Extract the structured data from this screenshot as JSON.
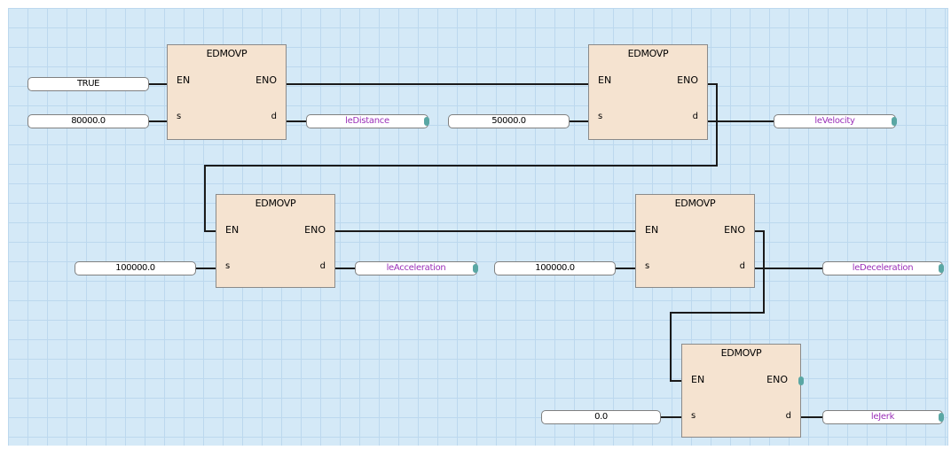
{
  "colors": {
    "grid_background": "#d4e9f7",
    "block_fill": "#f5e3d0",
    "variable_text": "#9a2fb8",
    "connector_dot": "#5aa7a4"
  },
  "blocks": [
    {
      "title": "EDMOVP",
      "en": "EN",
      "eno": "ENO",
      "s": "s",
      "d": "d"
    },
    {
      "title": "EDMOVP",
      "en": "EN",
      "eno": "ENO",
      "s": "s",
      "d": "d"
    },
    {
      "title": "EDMOVP",
      "en": "EN",
      "eno": "ENO",
      "s": "s",
      "d": "d"
    },
    {
      "title": "EDMOVP",
      "en": "EN",
      "eno": "ENO",
      "s": "s",
      "d": "d"
    },
    {
      "title": "EDMOVP",
      "en": "EN",
      "eno": "ENO",
      "s": "s",
      "d": "d"
    }
  ],
  "inputs": {
    "enable": "TRUE",
    "distance_value": "80000.0",
    "velocity_value": "50000.0",
    "acceleration_value": "100000.0",
    "deceleration_value": "100000.0",
    "jerk_value": "0.0"
  },
  "outputs": {
    "distance": "leDistance",
    "velocity": "leVelocity",
    "acceleration": "leAcceleration",
    "deceleration": "leDeceleration",
    "jerk": "leJerk"
  }
}
